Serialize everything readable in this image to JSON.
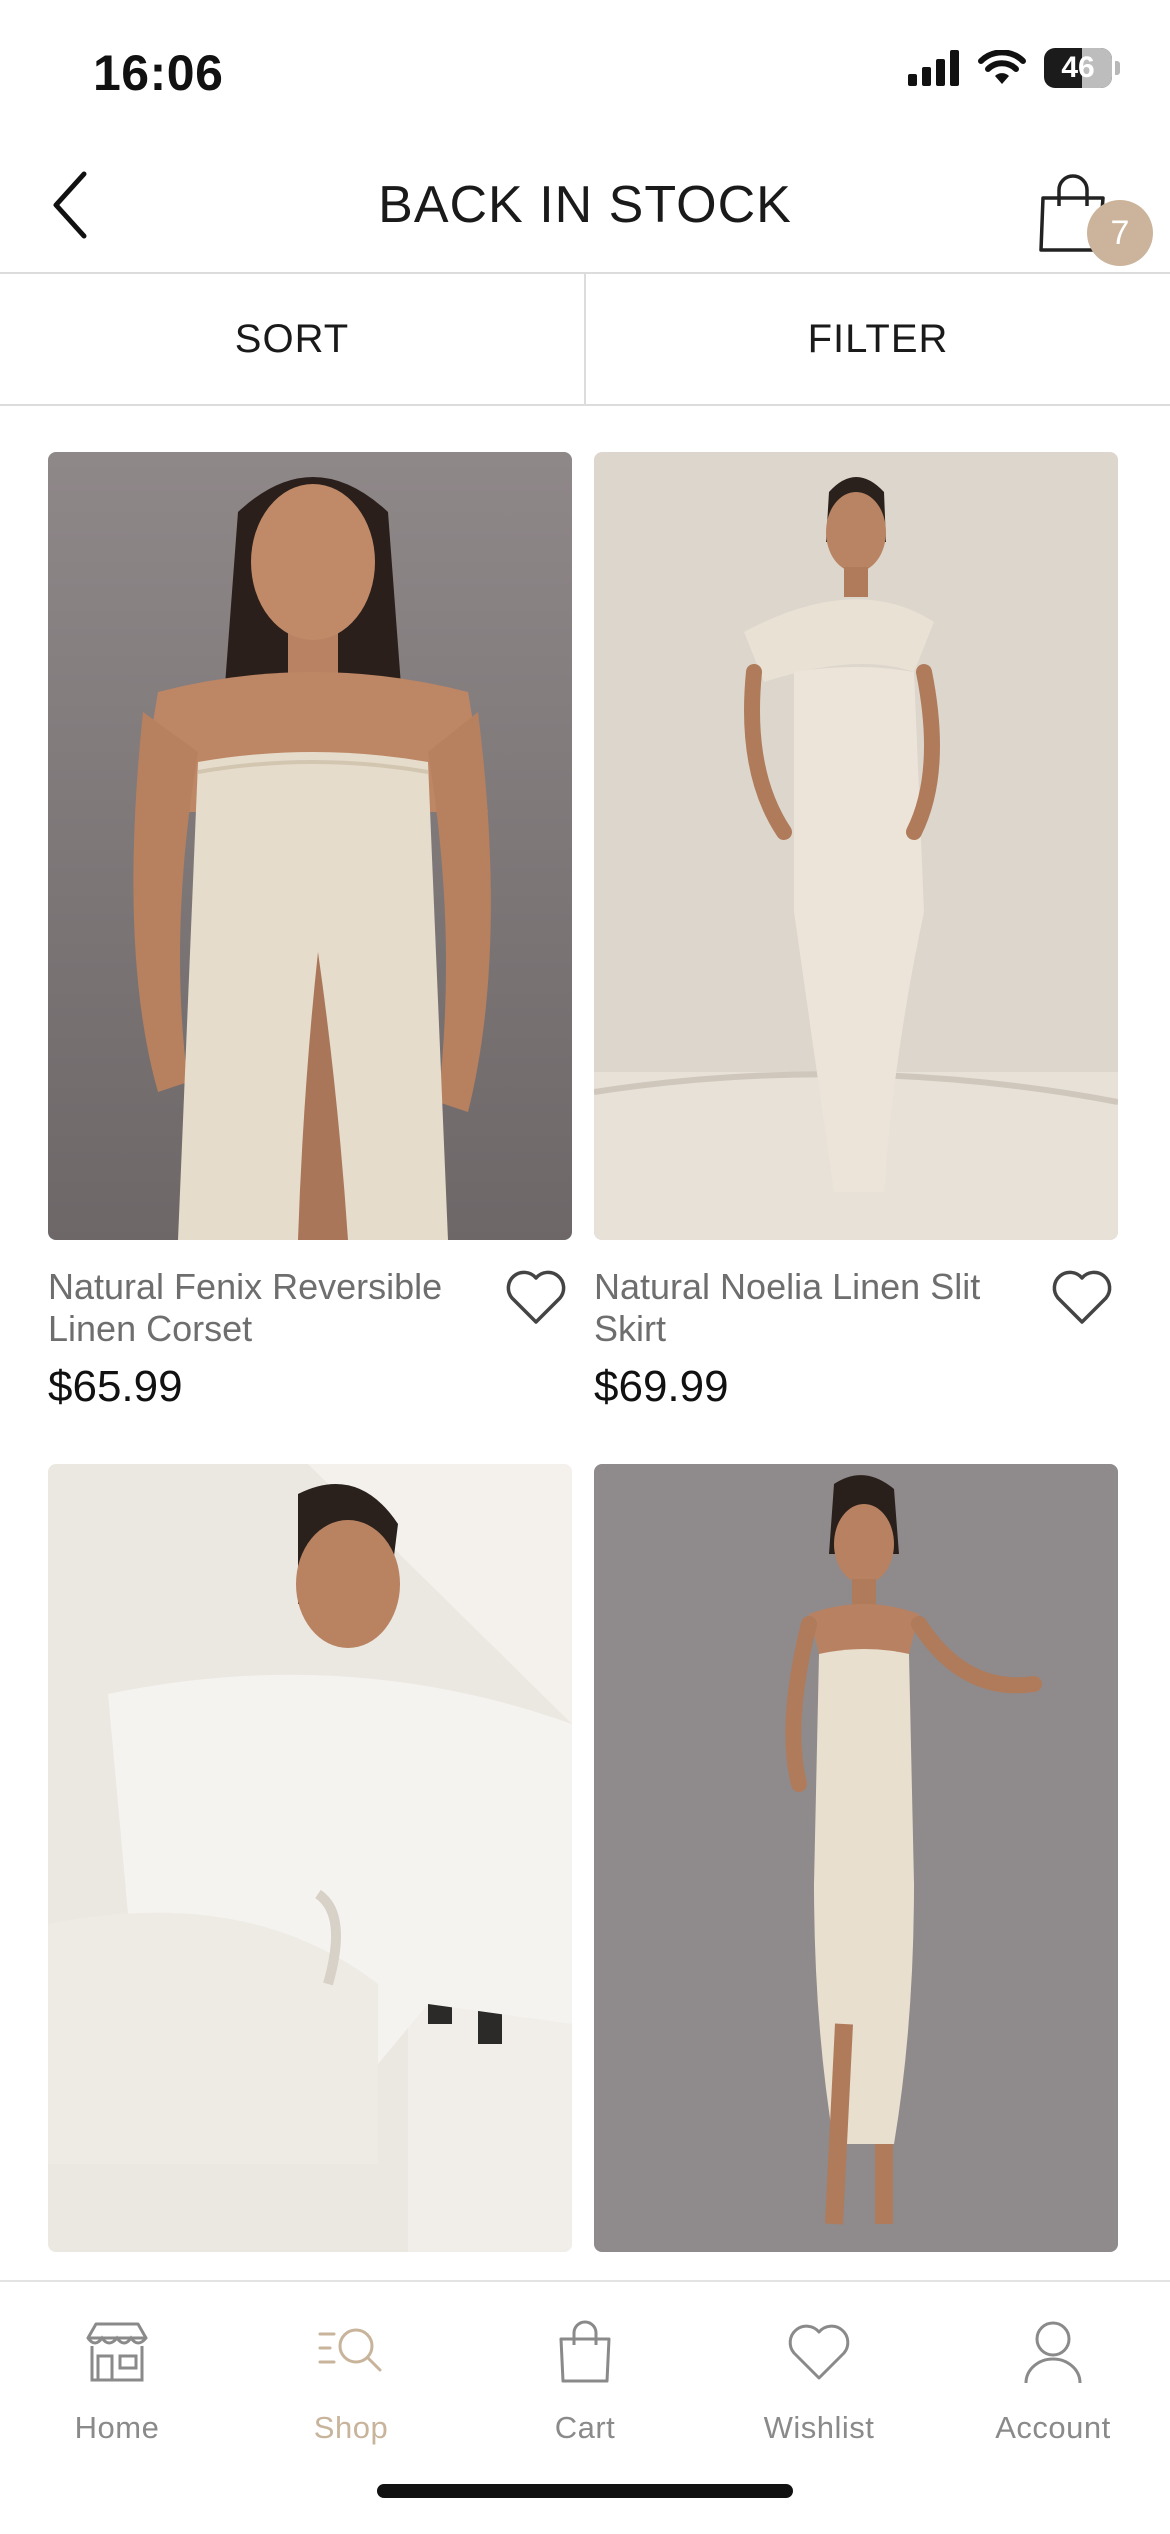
{
  "status_bar": {
    "time": "16:06",
    "battery": "46"
  },
  "header": {
    "title": "BACK IN STOCK",
    "cart_count": "7"
  },
  "toolbar": {
    "sort_label": "SORT",
    "filter_label": "FILTER"
  },
  "products": [
    {
      "name": "Natural Fenix Reversible Linen Corset",
      "price": "$65.99"
    },
    {
      "name": "Natural Noelia Linen Slit Skirt",
      "price": "$69.99"
    },
    {
      "name": "",
      "price": ""
    },
    {
      "name": "",
      "price": ""
    }
  ],
  "tabbar": {
    "items": [
      {
        "label": "Home",
        "icon": "store-icon"
      },
      {
        "label": "Shop",
        "icon": "shop-search-icon",
        "active": true
      },
      {
        "label": "Cart",
        "icon": "bag-icon"
      },
      {
        "label": "Wishlist",
        "icon": "heart-icon"
      },
      {
        "label": "Account",
        "icon": "user-icon"
      }
    ]
  },
  "colors": {
    "accent": "#c8b39b",
    "badge": "#cbb49b"
  }
}
